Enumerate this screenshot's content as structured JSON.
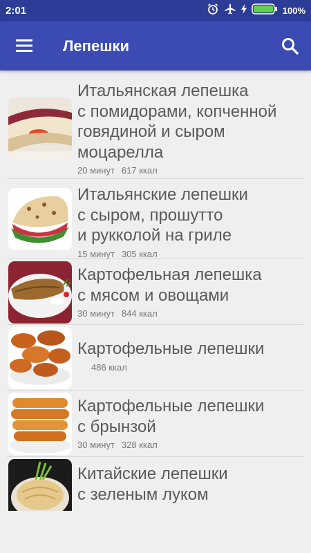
{
  "status_bar": {
    "time": "2:01",
    "battery": "100%"
  },
  "app_bar": {
    "title": "Лепешки",
    "menu_icon": "hamburger-menu-icon",
    "search_icon": "search-icon",
    "color": "#3b4bb3"
  },
  "recipes": [
    {
      "title": "Итальянская лепешка\nс помидорами, копченной\nговядиной и сыром\nмоцарелла",
      "time": "20 минут",
      "calories": "617 ккал",
      "image": "flatbread-wrap-photo"
    },
    {
      "title": "Итальянские лепешки\nс сыром, прошутто\nи рукколой на гриле",
      "time": "15 минут",
      "calories": "305 ккал",
      "image": "grilled-flatbread-photo"
    },
    {
      "title": "Картофельная лепешка\nс мясом и овощами",
      "time": "30 минут",
      "calories": "844 ккал",
      "image": "potato-pancake-meat-photo"
    },
    {
      "title": "Картофельные лепешки",
      "time": "",
      "calories": "486 ккал",
      "image": "potato-pancakes-photo"
    },
    {
      "title": "Картофельные лепешки\nс брынзой",
      "time": "30 минут",
      "calories": "328 ккал",
      "image": "potato-pancakes-cheese-photo"
    },
    {
      "title": "Китайские лепешки\nс зеленым луком",
      "time": "",
      "calories": "",
      "image": "chinese-scallion-pancake-photo"
    }
  ]
}
